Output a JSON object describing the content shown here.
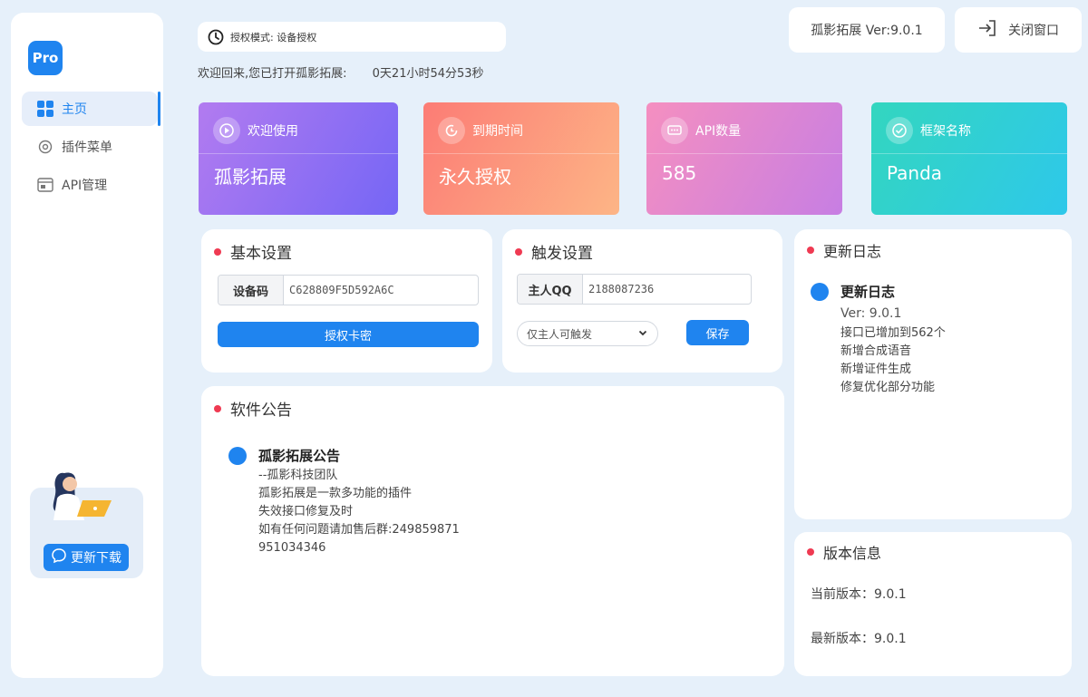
{
  "sidebar": {
    "logo": "Pro",
    "items": [
      {
        "label": "主页",
        "icon": "grid-icon"
      },
      {
        "label": "插件菜单",
        "icon": "gear-icon"
      },
      {
        "label": "API管理",
        "icon": "api-doc-icon"
      }
    ],
    "promo_button": "更新下载"
  },
  "header": {
    "mode_label": "授权模式: 设备授权",
    "welcome_text": "欢迎回来,您已打开孤影拓展:",
    "uptime": "0天21小时54分53秒",
    "version_label": "孤影拓展 Ver:9.0.1",
    "close_label": "关闭窗口"
  },
  "stats": [
    {
      "title": "欢迎使用",
      "value": "孤影拓展",
      "icon": "play-icon"
    },
    {
      "title": "到期时间",
      "value": "永久授权",
      "icon": "clock-icon"
    },
    {
      "title": "API数量",
      "value": "585",
      "icon": "chat-icon"
    },
    {
      "title": "框架名称",
      "value": "Panda",
      "icon": "check-icon"
    }
  ],
  "basic_settings": {
    "title": "基本设置",
    "device_label": "设备码",
    "device_value": "C628809F5D592A6C",
    "auth_button": "授权卡密"
  },
  "trigger_settings": {
    "title": "触发设置",
    "owner_label": "主人QQ",
    "owner_value": "2188087236",
    "trigger_option": "仅主人可触发",
    "save_button": "保存"
  },
  "announcement": {
    "title": "软件公告",
    "heading": "孤影拓展公告",
    "lines": [
      "--孤影科技团队",
      "孤影拓展是一款多功能的插件",
      "失效接口修复及时",
      "如有任何问题请加售后群:249859871",
      "951034346"
    ]
  },
  "changelog": {
    "title": "更新日志",
    "heading": "更新日志",
    "version": "Ver: 9.0.1",
    "lines": [
      "接口已增加到562个",
      "新增合成语音",
      "新增证件生成",
      "修复优化部分功能"
    ]
  },
  "version_info": {
    "title": "版本信息",
    "current": "当前版本：9.0.1",
    "latest": "最新版本：9.0.1"
  },
  "colors": {
    "accent": "#1f84ef",
    "dot_red": "#ef3a52"
  }
}
